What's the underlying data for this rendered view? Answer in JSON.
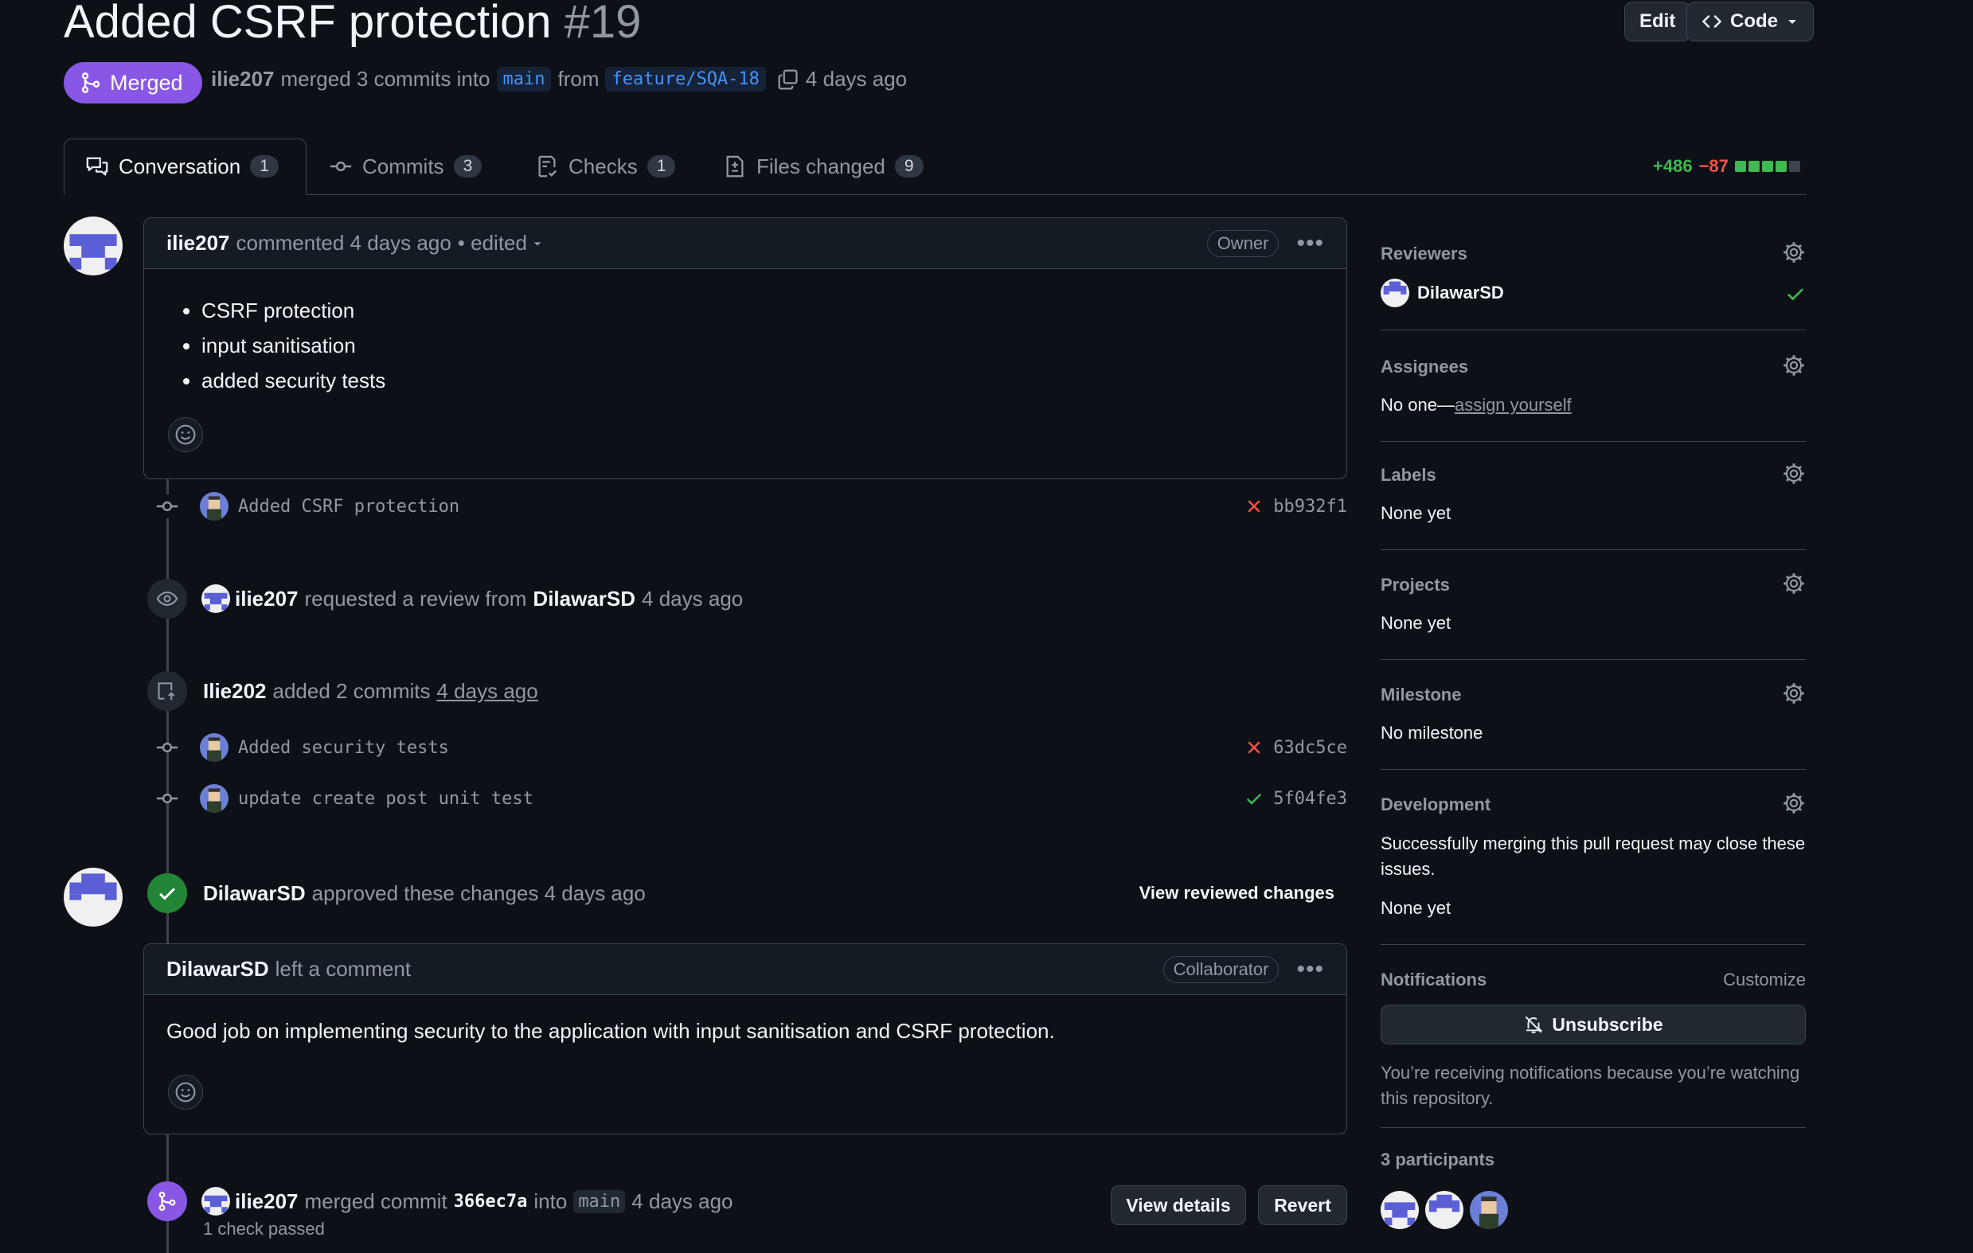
{
  "header": {
    "title": "Added CSRF protection",
    "number": "#19",
    "edit_label": "Edit",
    "code_label": "Code",
    "state_label": "Merged",
    "author": "ilie207",
    "merge_text": "merged 3 commits into",
    "base_branch": "main",
    "from_text": "from",
    "head_branch": "feature/SQA-18",
    "time": "4 days ago"
  },
  "tabs": [
    {
      "label": "Conversation",
      "count": "1"
    },
    {
      "label": "Commits",
      "count": "3"
    },
    {
      "label": "Checks",
      "count": "1"
    },
    {
      "label": "Files changed",
      "count": "9"
    }
  ],
  "diffstat": {
    "additions": "+486",
    "deletions": "−87"
  },
  "timeline": {
    "first_comment": {
      "author": "ilie207",
      "meta": "commented 4 days ago",
      "edited": "• edited",
      "role": "Owner",
      "items": [
        "CSRF protection",
        "input sanitisation",
        "added security tests"
      ]
    },
    "commit1": {
      "message": "Added CSRF protection",
      "sha": "bb932f1"
    },
    "review_request": {
      "actor": "ilie207",
      "text": "requested a review from",
      "reviewer": "DilawarSD",
      "time": "4 days ago"
    },
    "added_commits": {
      "actor": "Ilie202",
      "text": "added 2 commits",
      "time": "4 days ago"
    },
    "commit2": {
      "message": "Added security tests",
      "sha": "63dc5ce"
    },
    "commit3": {
      "message": "update create post unit test",
      "sha": "5f04fe3"
    },
    "approval": {
      "actor": "DilawarSD",
      "text": "approved these changes 4 days ago",
      "link": "View reviewed changes"
    },
    "review_comment": {
      "author": "DilawarSD",
      "meta": "left a comment",
      "role": "Collaborator",
      "body": "Good job on implementing security to the application with input sanitisation and CSRF protection."
    },
    "merge_event": {
      "actor": "ilie207",
      "text": "merged commit",
      "sha": "366ec7a",
      "into": "into",
      "branch": "main",
      "time": "4 days ago",
      "checks": "1 check passed",
      "details_label": "View details",
      "revert_label": "Revert"
    }
  },
  "sidebar": {
    "reviewers": {
      "heading": "Reviewers",
      "name": "DilawarSD"
    },
    "assignees": {
      "heading": "Assignees",
      "prefix": "No one—",
      "link": "assign yourself"
    },
    "labels": {
      "heading": "Labels",
      "value": "None yet"
    },
    "projects": {
      "heading": "Projects",
      "value": "None yet"
    },
    "milestone": {
      "heading": "Milestone",
      "value": "No milestone"
    },
    "development": {
      "heading": "Development",
      "desc": "Successfully merging this pull request may close these issues.",
      "value": "None yet"
    },
    "notifications": {
      "heading": "Notifications",
      "customize": "Customize",
      "button": "Unsubscribe",
      "desc": "You’re receiving notifications because you’re watching this repository."
    },
    "participants": {
      "heading": "3 participants"
    }
  },
  "colors": {
    "merged": "#8957e5",
    "success": "#3fb950",
    "danger": "#f85149",
    "link": "#4493f8"
  }
}
